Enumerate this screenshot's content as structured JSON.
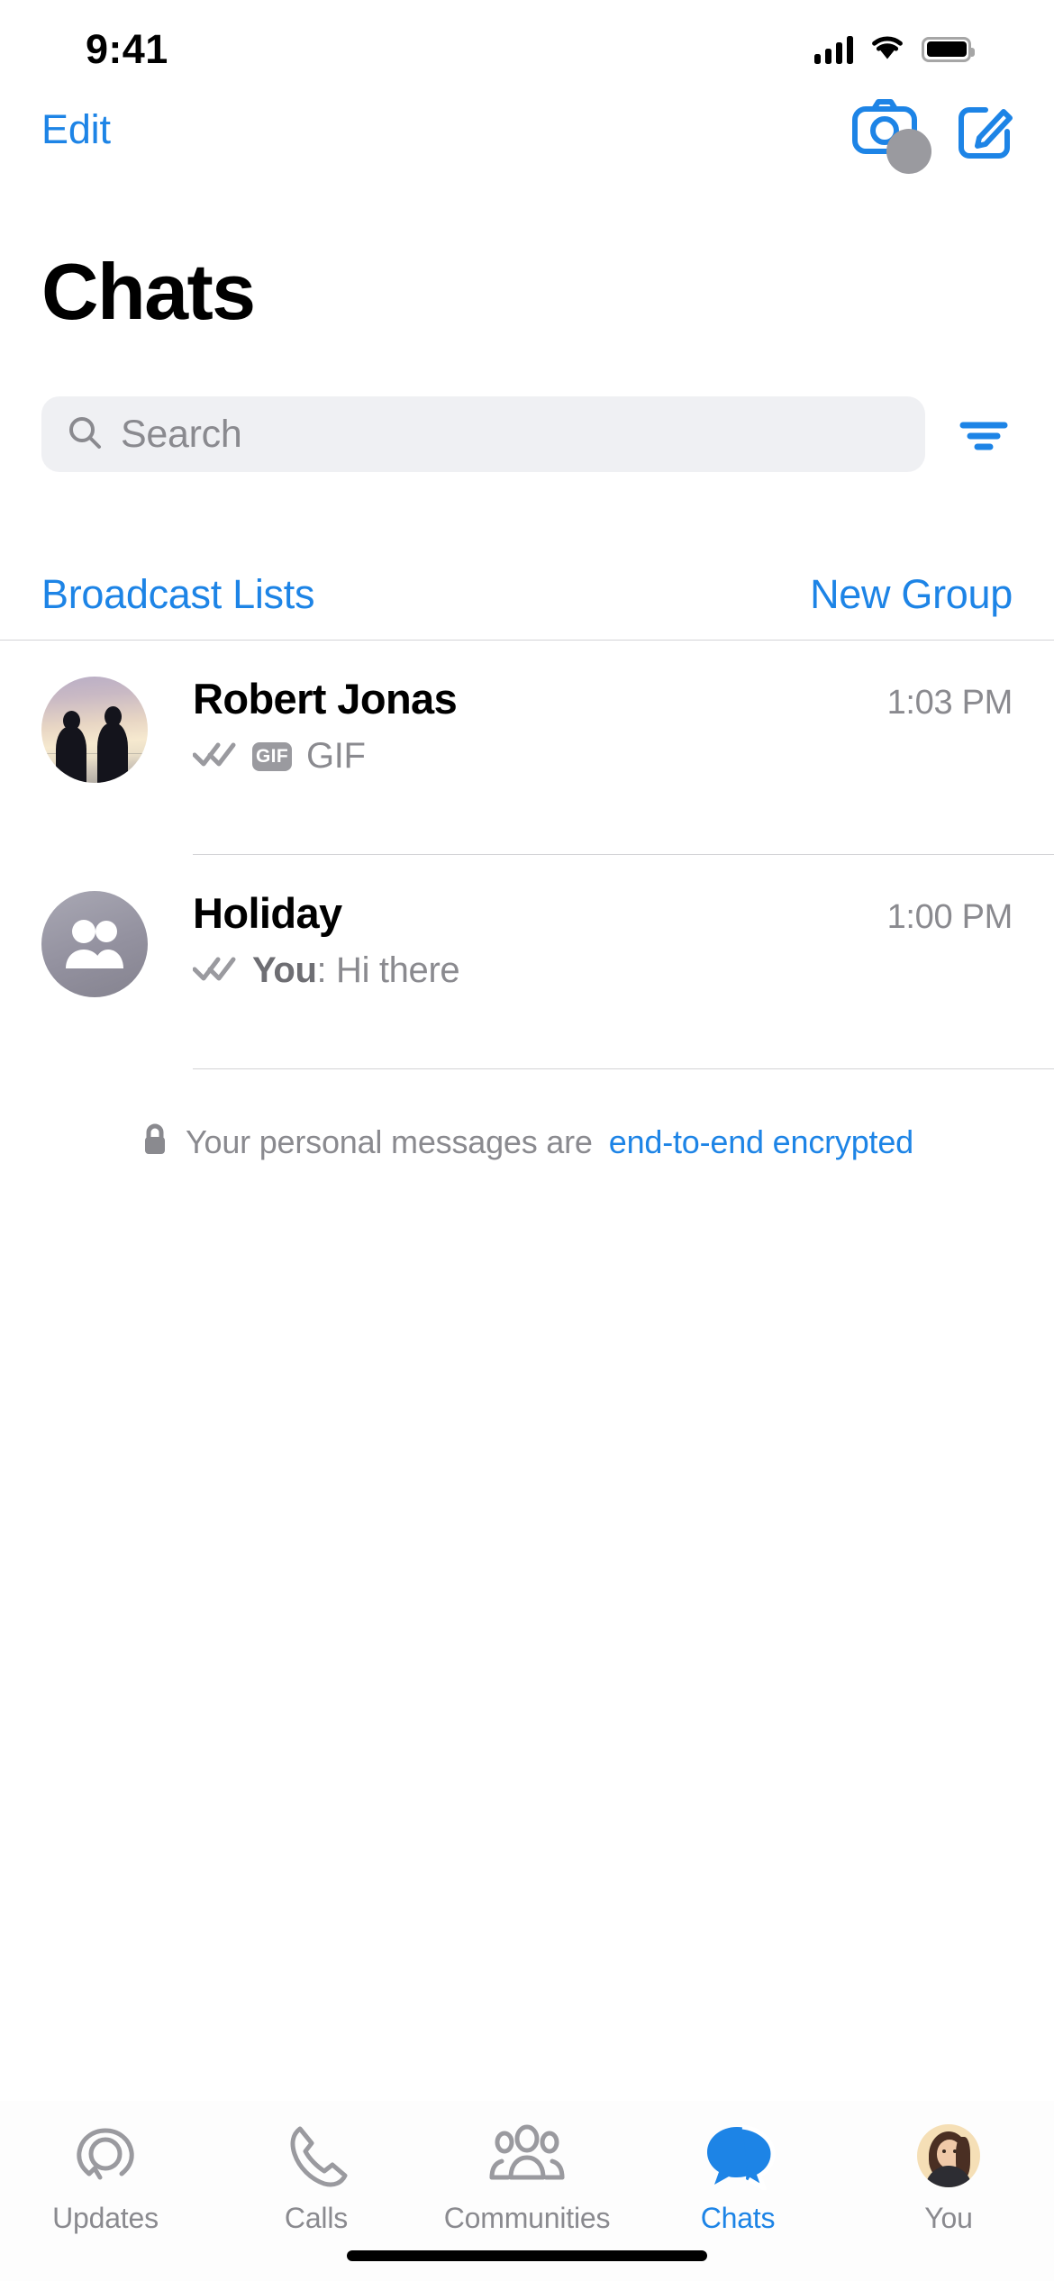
{
  "status_bar": {
    "time": "9:41",
    "cellular_icon": "cellular-signal-icon",
    "wifi_icon": "wifi-icon",
    "battery_icon": "battery-full-icon"
  },
  "nav": {
    "edit_label": "Edit",
    "camera_icon": "camera-icon",
    "compose_icon": "compose-new-chat-icon"
  },
  "header": {
    "title": "Chats"
  },
  "search": {
    "placeholder": "Search",
    "search_icon": "search-icon",
    "filter_icon": "filter-icon"
  },
  "quick_links": {
    "broadcast_label": "Broadcast Lists",
    "new_group_label": "New Group"
  },
  "chats": [
    {
      "name": "Robert Jonas",
      "time": "1:03 PM",
      "receipt_icon": "double-check-icon",
      "attachment_badge": "GIF",
      "preview": "GIF",
      "avatar_type": "photo-sunset-silhouettes"
    },
    {
      "name": "Holiday",
      "time": "1:00 PM",
      "receipt_icon": "double-check-icon",
      "preview_sender": "You",
      "preview": ": Hi there",
      "avatar_type": "group-people-icon"
    }
  ],
  "encryption_notice": {
    "lock_icon": "lock-icon",
    "text": "Your personal messages are ",
    "link": "end-to-end encrypted"
  },
  "tabbar": {
    "items": [
      {
        "label": "Updates",
        "icon": "updates-status-icon",
        "active": false
      },
      {
        "label": "Calls",
        "icon": "phone-icon",
        "active": false
      },
      {
        "label": "Communities",
        "icon": "communities-icon",
        "active": false
      },
      {
        "label": "Chats",
        "icon": "chat-bubbles-icon",
        "active": true
      },
      {
        "label": "You",
        "icon": "profile-memoji-avatar",
        "active": false
      }
    ]
  },
  "colors": {
    "accent_blue": "#1d84e6",
    "secondary_text": "#8a8a8f",
    "search_bg": "#eff0f3",
    "separator": "#d3d3d6"
  }
}
